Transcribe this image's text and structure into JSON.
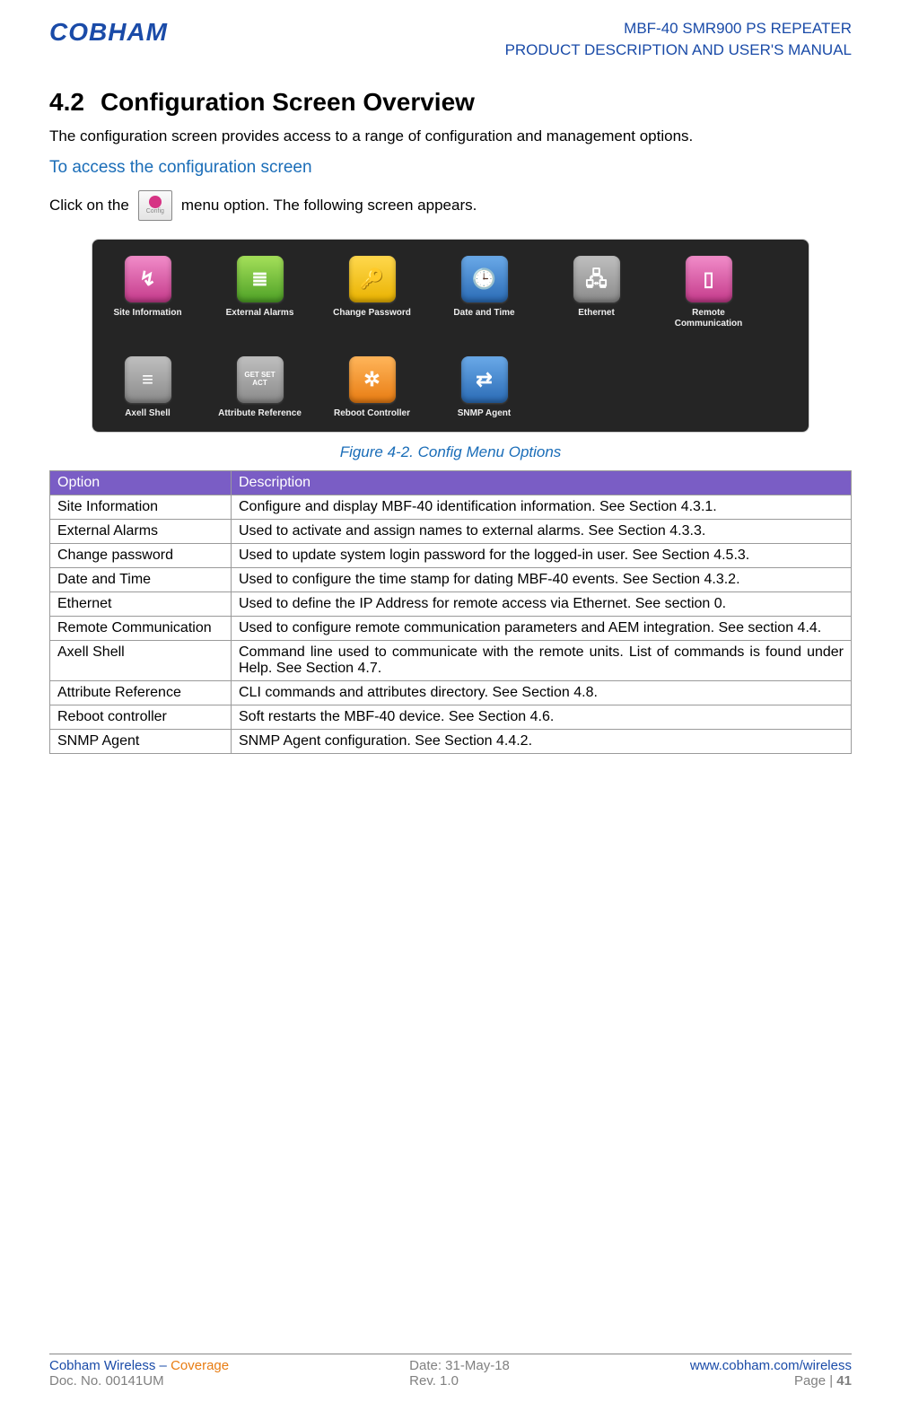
{
  "header": {
    "logo_text": "COBHAM",
    "line1": "MBF-40 SMR900 PS REPEATER",
    "line2": "PRODUCT DESCRIPTION AND USER'S MANUAL"
  },
  "section": {
    "number": "4.2",
    "title": "Configuration Screen Overview",
    "intro": "The configuration screen provides access to a range of configuration and management options.",
    "subhead": "To access the configuration screen",
    "click_pre": "Click on the",
    "config_label": "Config",
    "click_post": "menu option. The following screen appears."
  },
  "menu_icons": [
    {
      "label": "Site Information",
      "color": "bg-pink",
      "glyph": "↯"
    },
    {
      "label": "External Alarms",
      "color": "bg-green",
      "glyph": "≣"
    },
    {
      "label": "Change Password",
      "color": "bg-yellow",
      "glyph": "🔑"
    },
    {
      "label": "Date and Time",
      "color": "bg-blue",
      "glyph": "🕒"
    },
    {
      "label": "Ethernet",
      "color": "bg-gray",
      "glyph": "🖧"
    },
    {
      "label": "Remote Communication",
      "color": "bg-pink",
      "glyph": "▯"
    },
    {
      "label": "Axell Shell",
      "color": "bg-gray",
      "glyph": "≡"
    },
    {
      "label": "Attribute Reference",
      "color": "bg-gray",
      "glyph": "GET SET ACT"
    },
    {
      "label": "Reboot Controller",
      "color": "bg-orange",
      "glyph": "✲"
    },
    {
      "label": "SNMP Agent",
      "color": "bg-blue",
      "glyph": "⇄"
    }
  ],
  "figure_caption": "Figure 4-2. Config Menu Options",
  "table": {
    "headers": {
      "option": "Option",
      "description": "Description"
    },
    "rows": [
      {
        "option": "Site Information",
        "description": "Configure and display MBF-40 identification information. See Section 4.3.1."
      },
      {
        "option": "External Alarms",
        "description": "Used to activate and assign names to external alarms. See Section 4.3.3."
      },
      {
        "option": "Change password",
        "description": "Used to update system login password for the logged-in user. See Section 4.5.3."
      },
      {
        "option": "Date and Time",
        "description": "Used to configure the time stamp for dating MBF-40 events. See Section 4.3.2."
      },
      {
        "option": "Ethernet",
        "description": "Used to define the IP Address for remote access via Ethernet. See section 0."
      },
      {
        "option": "Remote Communication",
        "description": "Used to configure remote communication parameters and AEM integration. See section 4.4."
      },
      {
        "option": "Axell Shell",
        "description": "Command line used to communicate with the remote units. List of commands is found under Help. See Section 4.7."
      },
      {
        "option": "Attribute Reference",
        "description": "CLI commands and attributes directory. See Section 4.8."
      },
      {
        "option": "Reboot controller",
        "description": "Soft restarts the MBF-40 device. See Section 4.6."
      },
      {
        "option": "SNMP Agent",
        "description": "SNMP Agent configuration. See Section 4.4.2."
      }
    ]
  },
  "footer": {
    "left1a": "Cobham Wireless",
    "left1b": " – ",
    "left1c": "Coverage",
    "left2": "Doc. No. 00141UM",
    "mid1": "Date: 31-May-18",
    "mid2": "Rev. 1.0",
    "right1": "www.cobham.com/wireless",
    "right2a": "Page | ",
    "right2b": "41"
  }
}
